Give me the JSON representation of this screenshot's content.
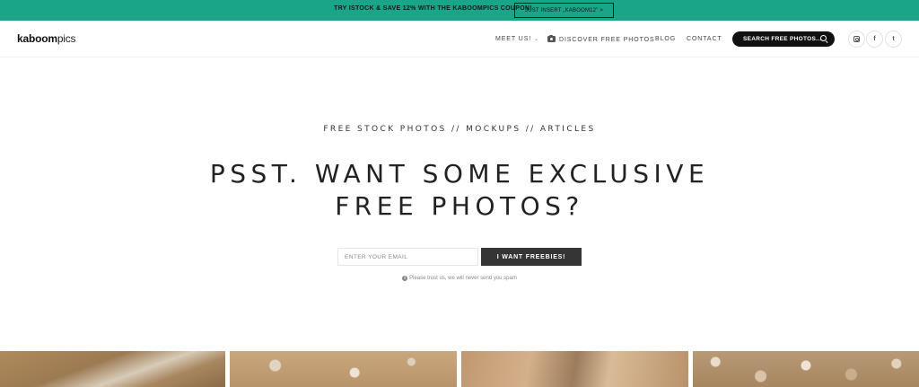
{
  "promo": {
    "text": "TRY ISTOCK & SAVE 12% WITH THE KABOOMPICS COUPON!",
    "button": "JUST INSERT „KABOOM12” >"
  },
  "nav": {
    "logo_bold": "kaboom",
    "logo_light": "pics",
    "items": [
      {
        "label": "MEET US!",
        "icon": "chevron-down-icon"
      },
      {
        "label": "DISCOVER FREE PHOTOS",
        "icon": "camera-icon"
      },
      {
        "label": "BLOG"
      },
      {
        "label": "CONTACT"
      }
    ],
    "search_label": "SEARCH FREE PHOTOS...",
    "social": [
      {
        "icon": "instagram-icon"
      },
      {
        "icon": "facebook-icon",
        "glyph": "f"
      },
      {
        "icon": "twitter-icon",
        "glyph": "t"
      }
    ]
  },
  "hero": {
    "tagline": "FREE STOCK PHOTOS // MOCKUPS // ARTICLES",
    "headline": "PSST. WANT SOME EXCLUSIVE FREE PHOTOS?",
    "email_placeholder": "ENTER YOUR EMAIL",
    "submit_label": "I WANT FREEBIES!",
    "spam_note": "Please trust us, we will never send you spam"
  },
  "colors": {
    "promo_bg": "#1aa589",
    "button_dark": "#353535",
    "search_bg": "#111111"
  }
}
